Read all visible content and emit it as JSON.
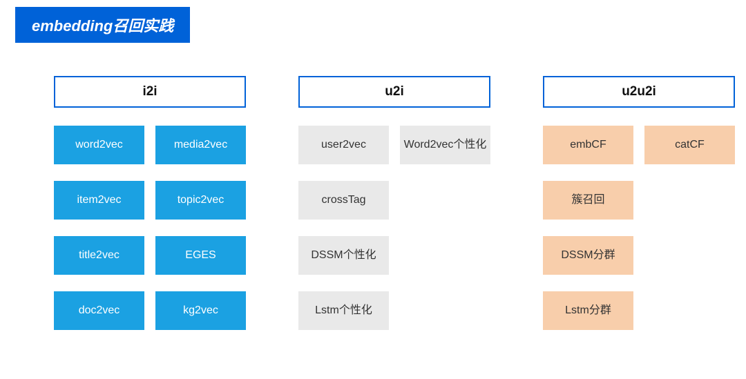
{
  "title": "embedding召回实践",
  "columns": [
    {
      "header": "i2i",
      "style": "blue",
      "items": [
        "word2vec",
        "media2vec",
        "item2vec",
        "topic2vec",
        "title2vec",
        "EGES",
        "doc2vec",
        "kg2vec"
      ]
    },
    {
      "header": "u2i",
      "style": "gray",
      "items": [
        "user2vec",
        "Word2vec个性化",
        "crossTag",
        "",
        "DSSM个性化",
        "",
        "Lstm个性化",
        ""
      ]
    },
    {
      "header": "u2u2i",
      "style": "orange",
      "items": [
        "embCF",
        "catCF",
        "簇召回",
        "",
        "DSSM分群",
        "",
        "Lstm分群",
        ""
      ]
    }
  ]
}
